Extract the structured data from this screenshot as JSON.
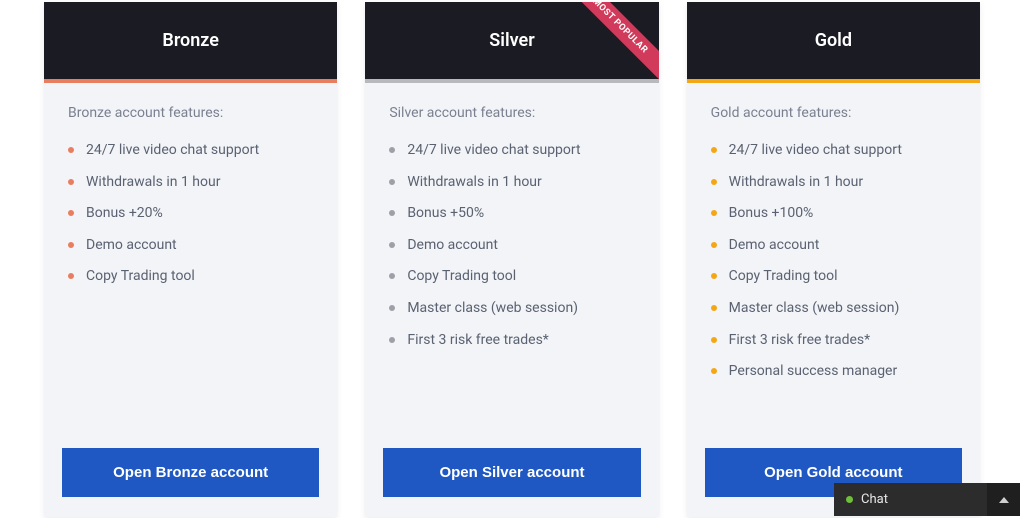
{
  "colors": {
    "accent_bronze": "#e97d5f",
    "accent_silver": "#b7b9bd",
    "accent_gold": "#f3a715",
    "bullet_bronze": "#e97d5f",
    "bullet_silver": "#9da0a7",
    "bullet_gold": "#f3a715"
  },
  "badge": {
    "label": "MOST POPULAR"
  },
  "plans": [
    {
      "key": "bronze",
      "title": "Bronze",
      "features_title": "Bronze account features:",
      "features": [
        "24/7 live video chat support",
        "Withdrawals in 1 hour",
        "Bonus +20%",
        "Demo account",
        "Copy Trading tool"
      ],
      "cta": "Open Bronze account",
      "accent": "accent_bronze",
      "bullet": "bullet_bronze",
      "badge": false
    },
    {
      "key": "silver",
      "title": "Silver",
      "features_title": "Silver account features:",
      "features": [
        "24/7 live video chat support",
        "Withdrawals in 1 hour",
        "Bonus +50%",
        "Demo account",
        "Copy Trading tool",
        "Master class (web session)",
        "First 3 risk free trades*"
      ],
      "cta": "Open Silver account",
      "accent": "accent_silver",
      "bullet": "bullet_silver",
      "badge": true
    },
    {
      "key": "gold",
      "title": "Gold",
      "features_title": "Gold account features:",
      "features": [
        "24/7 live video chat support",
        "Withdrawals in 1 hour",
        "Bonus +100%",
        "Demo account",
        "Copy Trading tool",
        "Master class (web session)",
        "First 3 risk free trades*",
        "Personal success manager"
      ],
      "cta": "Open Gold account",
      "accent": "accent_gold",
      "bullet": "bullet_gold",
      "badge": false
    }
  ],
  "chat": {
    "label": "Chat"
  }
}
